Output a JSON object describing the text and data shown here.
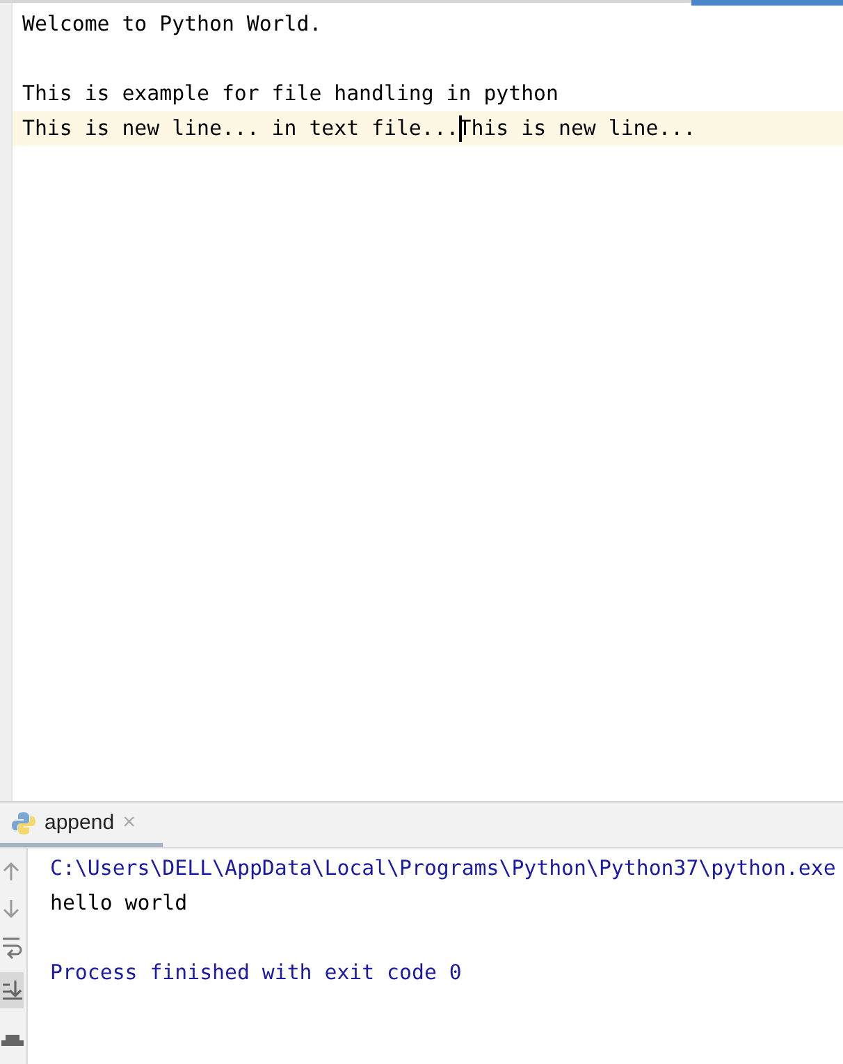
{
  "editor": {
    "lines": [
      {
        "text": "Welcome to Python World.",
        "current": false
      },
      {
        "current": false
      },
      {
        "text": "This is example for file handling in python",
        "current": false
      },
      {
        "text": "This is new line... in text file...",
        "after_caret": "This is new line...",
        "current": true
      }
    ]
  },
  "run_panel": {
    "tabs": [
      {
        "label": "append",
        "selected": true,
        "close": "×"
      }
    ],
    "toolbar": [
      {
        "kind": "up",
        "selected": false
      },
      {
        "kind": "down",
        "selected": false
      },
      {
        "kind": "wrap",
        "selected": false
      },
      {
        "kind": "scroll-end",
        "selected": true
      },
      {
        "kind": "print",
        "selected": false
      }
    ],
    "console": [
      {
        "text": "C:\\Users\\DELL\\AppData\\Local\\Programs\\Python\\Python37\\python.exe",
        "kind": "system"
      },
      {
        "text": "hello world",
        "kind": "output"
      },
      {
        "kind": "output"
      },
      {
        "text": "Process finished with exit code 0",
        "kind": "system"
      }
    ]
  }
}
